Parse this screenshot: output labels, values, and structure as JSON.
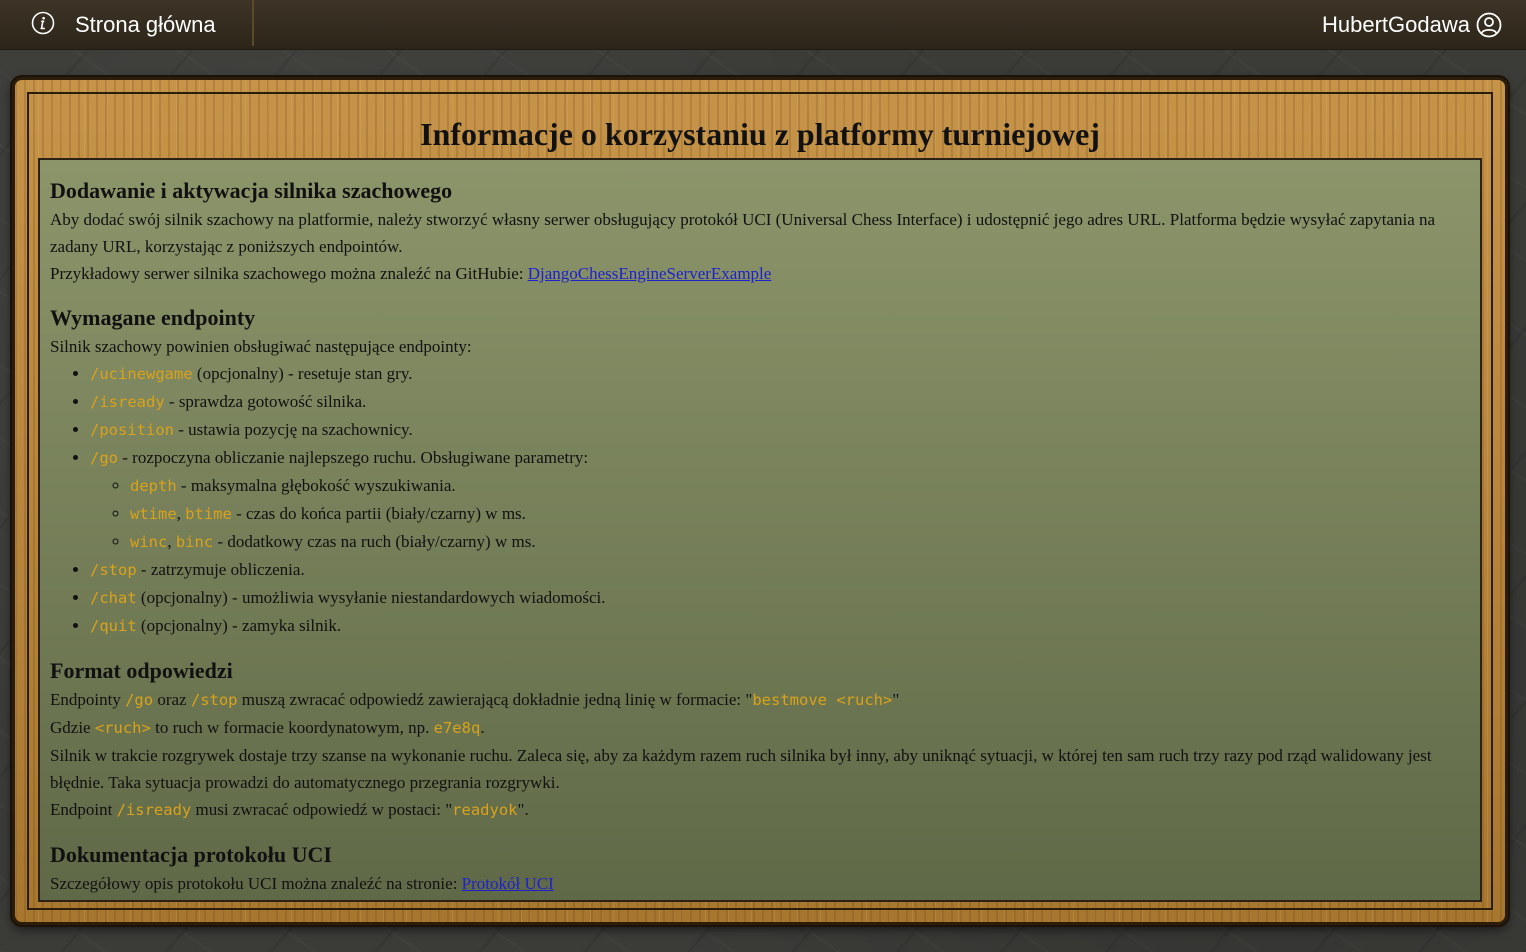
{
  "navbar": {
    "home_label": "Strona główna",
    "user_name": "HubertGodawa",
    "icons": {
      "home": "info-circle-icon",
      "user": "user-circle-icon"
    }
  },
  "page": {
    "title": "Informacje o korzystaniu z platformy turniejowej"
  },
  "sections": {
    "engine": {
      "heading": "Dodawanie i aktywacja silnika szachowego",
      "para1": "Aby dodać swój silnik szachowy na platformie, należy stworzyć własny serwer obsługujący protokół UCI (Universal Chess Interface) i udostępnić jego adres URL. Platforma będzie wysyłać zapytania na zadany URL, korzystając z poniższych endpointów.",
      "para2_prefix": "Przykładowy serwer silnika szachowego można znaleźć na GitHubie: ",
      "github_link": "DjangoChessEngineServerExample"
    },
    "endpoints": {
      "heading": "Wymagane endpointy",
      "intro": "Silnik szachowy powinien obsługiwać następujące endpointy:",
      "items": [
        {
          "code": "/ucinewgame",
          "text": " (opcjonalny) - resetuje stan gry."
        },
        {
          "code": "/isready",
          "text": " - sprawdza gotowość silnika."
        },
        {
          "code": "/position",
          "text": " - ustawia pozycję na szachownicy."
        },
        {
          "code": "/go",
          "text": " - rozpoczyna obliczanie najlepszego ruchu. Obsługiwane parametry:"
        },
        {
          "code": "/stop",
          "text": " - zatrzymuje obliczenia."
        },
        {
          "code": "/chat",
          "text": " (opcjonalny) - umożliwia wysyłanie niestandardowych wiadomości."
        },
        {
          "code": "/quit",
          "text": " (opcjonalny) - zamyka silnik."
        }
      ],
      "go_params": [
        {
          "code1": "depth",
          "sep": "",
          "code2": "",
          "text": " - maksymalna głębokość wyszukiwania."
        },
        {
          "code1": "wtime",
          "sep": ", ",
          "code2": "btime",
          "text": " - czas do końca partii (biały/czarny) w ms."
        },
        {
          "code1": "winc",
          "sep": ", ",
          "code2": "binc",
          "text": " - dodatkowy czas na ruch (biały/czarny) w ms."
        }
      ]
    },
    "format": {
      "heading": "Format odpowiedzi",
      "l1_a": "Endpointy ",
      "l1_code1": "/go",
      "l1_b": " oraz ",
      "l1_code2": "/stop",
      "l1_c": " muszą zwracać odpowiedź zawierającą dokładnie jedną linię w formacie: \"",
      "l1_code3": "bestmove <ruch>",
      "l1_d": "\"",
      "l2_a": "Gdzie ",
      "l2_code1": "<ruch>",
      "l2_b": " to ruch w formacie koordynatowym, np. ",
      "l2_code2": "e7e8q",
      "l2_c": ".",
      "l3": "Silnik w trakcie rozgrywek dostaje trzy szanse na wykonanie ruchu. Zaleca się, aby za każdym razem ruch silnika był inny, aby uniknąć sytuacji, w której ten sam ruch trzy razy pod rząd walidowany jest błędnie. Taka sytuacja prowadzi do automatycznego przegrania rozgrywki.",
      "l4_a": "Endpoint ",
      "l4_code1": "/isready",
      "l4_b": " musi zwracać odpowiedź w postaci: \"",
      "l4_code2": "readyok",
      "l4_c": "\"."
    },
    "docs": {
      "heading": "Dokumentacja protokołu UCI",
      "text": "Szczegółowy opis protokołu UCI można znaleźć na stronie: ",
      "link": "Protokół UCI"
    }
  },
  "colors": {
    "navbar_bg": "#2c2519",
    "frame_wood": "#b7863e",
    "panel_top": "#8c956a",
    "panel_bottom": "#5f6947",
    "code": "#d9a21b",
    "link": "#1d22cc"
  }
}
